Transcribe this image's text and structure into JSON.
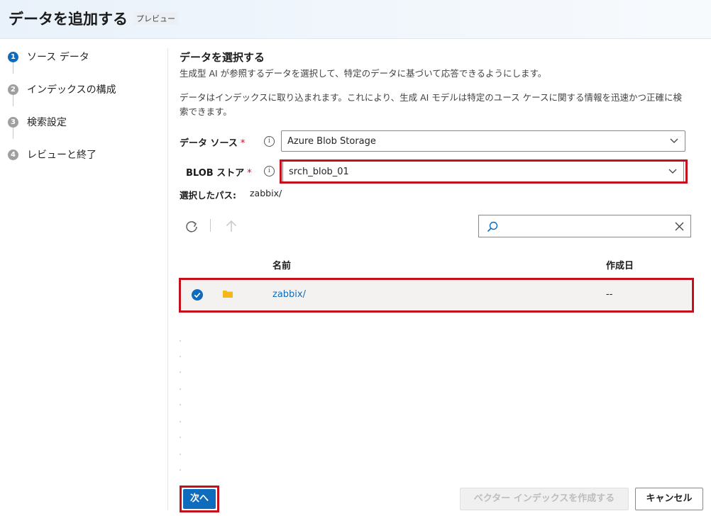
{
  "header": {
    "title": "データを追加する",
    "badge": "プレビュー"
  },
  "steps": [
    {
      "number": "1",
      "label": "ソース データ",
      "active": true
    },
    {
      "number": "2",
      "label": "インデックスの構成",
      "active": false
    },
    {
      "number": "3",
      "label": "検索設定",
      "active": false
    },
    {
      "number": "4",
      "label": "レビューと終了",
      "active": false
    }
  ],
  "main": {
    "title": "データを選択する",
    "description": "生成型 AI が参照するデータを選択して、特定のデータに基づいて応答できるようにします。",
    "info": "データはインデックスに取り込まれます。これにより、生成 AI モデルは特定のユース ケースに関する情報を迅速かつ正確に検索できます。"
  },
  "form": {
    "data_source": {
      "label": "データ ソース",
      "required_mark": "*",
      "info_icon": "i",
      "value": "Azure Blob Storage"
    },
    "blob_store": {
      "label": "BLOB ストア",
      "required_mark": "*",
      "info_icon": "i",
      "value": "srch_blob_01"
    },
    "selected_path": {
      "label": "選択したパス:",
      "value": "zabbix/"
    }
  },
  "toolbar": {
    "refresh_icon": "refresh-icon",
    "up_icon": "arrow-up-icon"
  },
  "search": {
    "value": "",
    "placeholder": ""
  },
  "table": {
    "columns": [
      "名前",
      "作成日"
    ],
    "rows": [
      {
        "selected": true,
        "type": "folder",
        "name": "zabbix/",
        "created": "--"
      }
    ]
  },
  "footer": {
    "next_label": "次へ",
    "create_vector_label": "ベクター インデックスを作成する",
    "cancel_label": "キャンセル"
  },
  "colors": {
    "accent": "#0f6cbd",
    "highlight_border": "#c4101b",
    "folder": "#f6b818"
  }
}
